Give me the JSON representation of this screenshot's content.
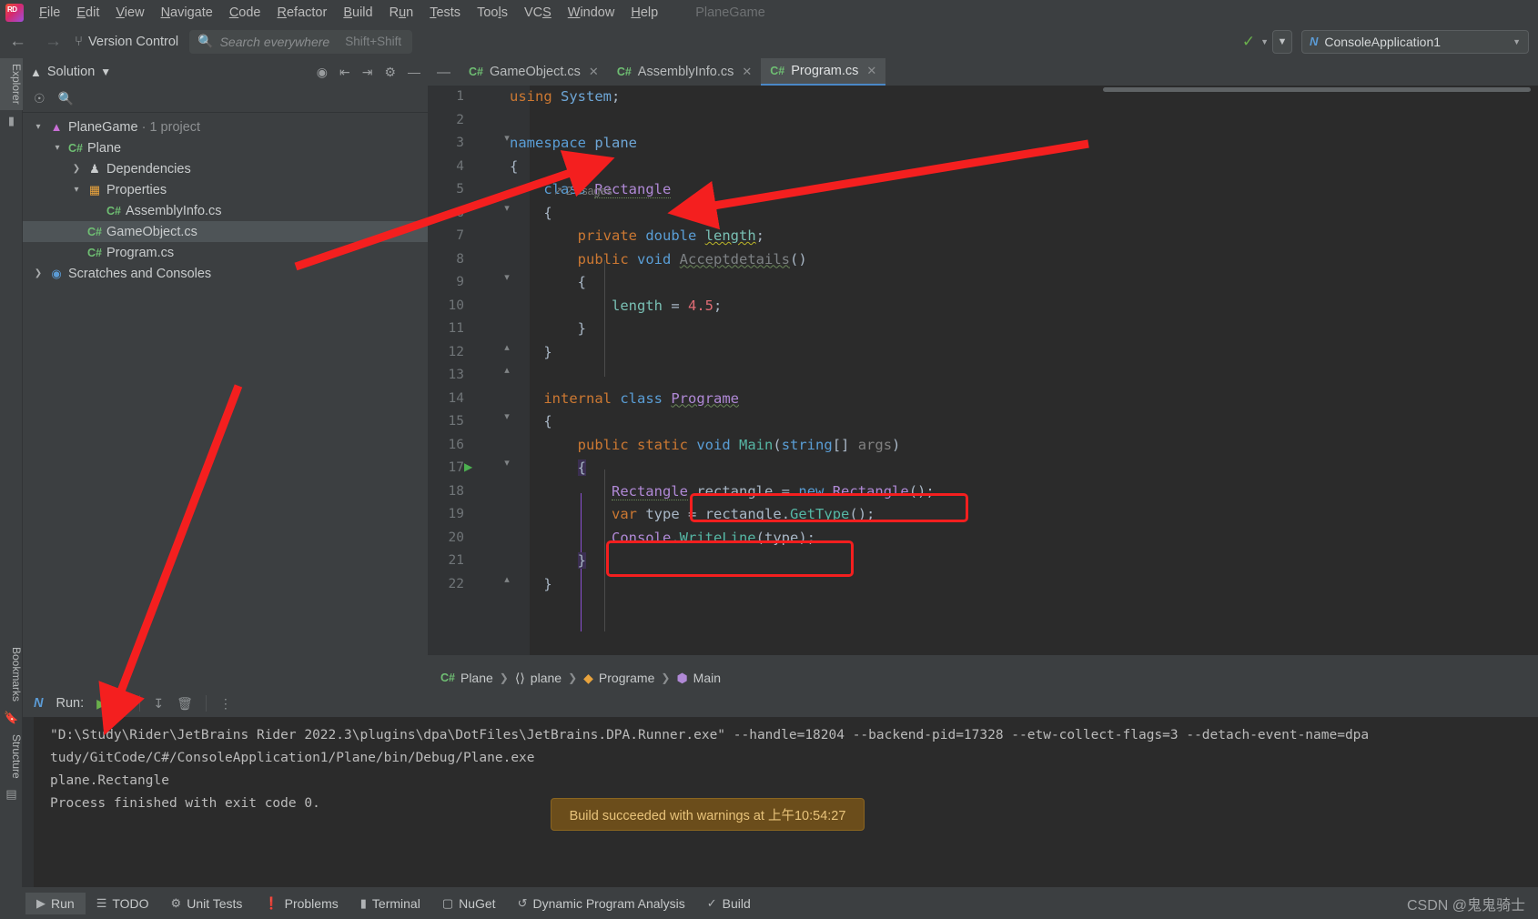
{
  "app": {
    "logo_icon": "rider-logo",
    "project_ghost": "PlaneGame",
    "watermark": "CSDN @鬼鬼骑士"
  },
  "menubar": {
    "items": [
      {
        "label": "File"
      },
      {
        "label": "Edit"
      },
      {
        "label": "View"
      },
      {
        "label": "Navigate"
      },
      {
        "label": "Code"
      },
      {
        "label": "Refactor"
      },
      {
        "label": "Build"
      },
      {
        "label": "Run"
      },
      {
        "label": "Tests"
      },
      {
        "label": "Tools"
      },
      {
        "label": "VCS"
      },
      {
        "label": "Window"
      },
      {
        "label": "Help"
      }
    ]
  },
  "toolbar": {
    "back_icon": "←",
    "forward_icon": "→",
    "vcs_label": "Version Control",
    "vcs_icon": "branch-icon",
    "search": {
      "placeholder": "Search everywhere",
      "hint": "Shift+Shift",
      "icon": "search-icon"
    },
    "build_icon": "hammer-icon",
    "run_config": "ConsoleApplication1",
    "run_config_icon": "dotnet-icon"
  },
  "left_rail": {
    "explorer_label": "Explorer",
    "bookmarks_label": "Bookmarks",
    "structure_label": "Structure",
    "folder_icon": "folder-icon"
  },
  "solution": {
    "title": "Solution",
    "tools": [
      "locate-icon",
      "expand-all-icon",
      "collapse-all-icon",
      "settings-icon",
      "minimize-icon"
    ],
    "search_icons": [
      "filter-icon",
      "search-icon"
    ],
    "tree": [
      {
        "label": "PlaneGame",
        "suffix": " · 1 project",
        "indent": 0,
        "twisty": "v",
        "icon": "solution-icon",
        "selected": false,
        "type": "solution"
      },
      {
        "label": "Plane",
        "suffix": "",
        "indent": 1,
        "twisty": "v",
        "icon": "csproj-icon",
        "selected": false,
        "type": "project"
      },
      {
        "label": "Dependencies",
        "suffix": "",
        "indent": 2,
        "twisty": ">",
        "icon": "dependencies-icon",
        "selected": false,
        "type": "node"
      },
      {
        "label": "Properties",
        "suffix": "",
        "indent": 2,
        "twisty": "v",
        "icon": "properties-icon",
        "selected": false,
        "type": "node"
      },
      {
        "label": "AssemblyInfo.cs",
        "suffix": "",
        "indent": 3,
        "twisty": "",
        "icon": "cs-icon",
        "selected": false,
        "type": "file"
      },
      {
        "label": "GameObject.cs",
        "suffix": "",
        "indent": 2,
        "twisty": "",
        "icon": "cs-icon",
        "selected": true,
        "type": "file"
      },
      {
        "label": "Program.cs",
        "suffix": "",
        "indent": 2,
        "twisty": "",
        "icon": "cs-icon",
        "selected": false,
        "type": "file"
      },
      {
        "label": "Scratches and Consoles",
        "suffix": "",
        "indent": 0,
        "twisty": ">",
        "icon": "scratches-icon",
        "selected": false,
        "type": "node"
      }
    ]
  },
  "editor": {
    "tabs": [
      {
        "label": "GameObject.cs",
        "active": false,
        "closable": true
      },
      {
        "label": "AssemblyInfo.cs",
        "active": false,
        "closable": true
      },
      {
        "label": "Program.cs",
        "active": true,
        "closable": true
      }
    ],
    "usages_hint": "2 usages",
    "run_gutter_icon": "run-arrow-icon",
    "lines": [
      {
        "n": "1"
      },
      {
        "n": "2"
      },
      {
        "n": "3"
      },
      {
        "n": "4"
      },
      {
        "n": "5"
      },
      {
        "n": "6"
      },
      {
        "n": "7"
      },
      {
        "n": "8"
      },
      {
        "n": "9"
      },
      {
        "n": "10"
      },
      {
        "n": "11"
      },
      {
        "n": "12"
      },
      {
        "n": "13"
      },
      {
        "n": "14"
      },
      {
        "n": "15"
      },
      {
        "n": "16"
      },
      {
        "n": "17"
      },
      {
        "n": "18"
      },
      {
        "n": "19"
      },
      {
        "n": "20"
      },
      {
        "n": "21"
      },
      {
        "n": "22"
      }
    ],
    "code_text": [
      "using System;",
      "",
      "namespace plane",
      "{",
      "    class Rectangle",
      "    {",
      "        private double length;",
      "        public void Acceptdetails()",
      "        {",
      "            length = 4.5;",
      "        }",
      "    }",
      "",
      "    internal class Programe",
      "    {",
      "        public static void Main(string[] args)",
      "        {",
      "            Rectangle rectangle = new Rectangle();",
      "            var type = rectangle.GetType();",
      "            Console.WriteLine(type);",
      "        }",
      "    }"
    ],
    "breadcrumb": [
      {
        "label": "Plane",
        "icon": "csproj-icon"
      },
      {
        "label": "plane",
        "icon": "namespace-icon"
      },
      {
        "label": "Programe",
        "icon": "class-icon"
      },
      {
        "label": "Main",
        "icon": "method-icon"
      }
    ]
  },
  "run_panel": {
    "title": "Run:",
    "icon": "run-icon",
    "buttons": [
      "rerun-icon",
      "stop-icon",
      "scroll-to-end-icon",
      "trash-icon",
      "more-icon"
    ],
    "console_lines": [
      "\"D:\\Study\\Rider\\JetBrains Rider 2022.3\\plugins\\dpa\\DotFiles\\JetBrains.DPA.Runner.exe\" --handle=18204 --backend-pid=17328 --etw-collect-flags=3 --detach-event-name=dpa",
      "tudy/GitCode/C#/ConsoleApplication1/Plane/bin/Debug/Plane.exe",
      "",
      "plane.Rectangle",
      "",
      "Process finished with exit code 0."
    ]
  },
  "toast": {
    "message": "Build succeeded with warnings at 上午10:54:27",
    "bg_color": "#6b4d1b",
    "text_color": "#e8c37a"
  },
  "statusbar": {
    "items": [
      {
        "label": "Run",
        "icon": "run-icon",
        "active": true
      },
      {
        "label": "TODO",
        "icon": "todo-icon",
        "active": false
      },
      {
        "label": "Unit Tests",
        "icon": "unit-tests-icon",
        "active": false
      },
      {
        "label": "Problems",
        "icon": "problems-icon",
        "active": false
      },
      {
        "label": "Terminal",
        "icon": "terminal-icon",
        "active": false
      },
      {
        "label": "NuGet",
        "icon": "nuget-icon",
        "active": false
      },
      {
        "label": "Dynamic Program Analysis",
        "icon": "dpa-icon",
        "active": false
      },
      {
        "label": "Build",
        "icon": "build-icon",
        "active": false
      }
    ]
  },
  "annotations": {
    "arrow_color": "#f41f1f",
    "highlight_boxes": 2,
    "arrows": 3
  }
}
